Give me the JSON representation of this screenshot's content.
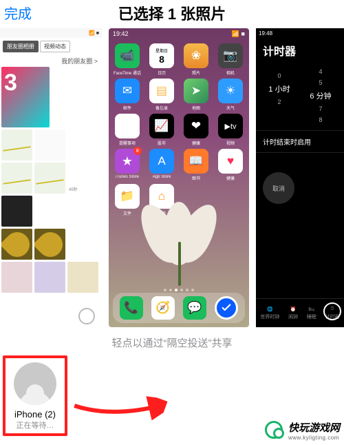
{
  "header": {
    "done": "完成",
    "title": "已选择 1 张照片"
  },
  "left": {
    "tabs": [
      "朋友圈相册",
      "视频动态"
    ],
    "friends_link": "我的朋友圈 >",
    "duration": "45秒"
  },
  "mid": {
    "time": "19:42",
    "apps": [
      [
        {
          "n": "FaceTime 通话",
          "g": "📹",
          "c": "i-ft"
        },
        {
          "n": "日历",
          "g": "8",
          "c": "i-cal",
          "day": "星期日"
        },
        {
          "n": "照片",
          "g": "❀",
          "c": "i-ph"
        },
        {
          "n": "相机",
          "g": "📷",
          "c": "i-cam"
        }
      ],
      [
        {
          "n": "邮件",
          "g": "✉",
          "c": "i-mail"
        },
        {
          "n": "备忘录",
          "g": "▤",
          "c": "i-note"
        },
        {
          "n": "地图",
          "g": "➤",
          "c": "i-map"
        },
        {
          "n": "天气",
          "g": "☀",
          "c": "i-wx"
        }
      ],
      [
        {
          "n": "提醒事项",
          "g": "",
          "c": "i-rem"
        },
        {
          "n": "股市",
          "g": "📈",
          "c": "i-stk"
        },
        {
          "n": "健康",
          "g": "❤",
          "c": "i-hlt"
        },
        {
          "n": "视频",
          "g": "▶tv",
          "c": "i-tv"
        }
      ],
      [
        {
          "n": "iTunes Store",
          "g": "★",
          "c": "i-it",
          "badge": "8"
        },
        {
          "n": "App Store",
          "g": "A",
          "c": "i-as"
        },
        {
          "n": "图书",
          "g": "📖",
          "c": "i-bk"
        },
        {
          "n": "健康",
          "g": "♥",
          "c": "i-he"
        }
      ],
      [
        {
          "n": "文件",
          "g": "📁",
          "c": "i-fl"
        },
        {
          "n": "家庭",
          "g": "⌂",
          "c": "i-hm"
        }
      ]
    ]
  },
  "right": {
    "time": "19:48",
    "title": "计时器",
    "hours_sel": "1 小时",
    "mins_sel": "6 分钟",
    "col_h": [
      "",
      "0",
      "1 小时",
      "2",
      ""
    ],
    "col_m": [
      "4",
      "5",
      "6 分钟",
      "7",
      "8"
    ],
    "end_row": "计时结束时启用",
    "cancel": "取消",
    "tabs": [
      "世界时钟",
      "闹钟",
      "睡眠",
      "计时器"
    ]
  },
  "hint": "轻点以通过“隔空投送”共享",
  "share": {
    "name": "iPhone (2)",
    "status": "正在等待…"
  },
  "watermark": {
    "brand": "快玩游戏网",
    "url": "www.kyligting.com"
  }
}
